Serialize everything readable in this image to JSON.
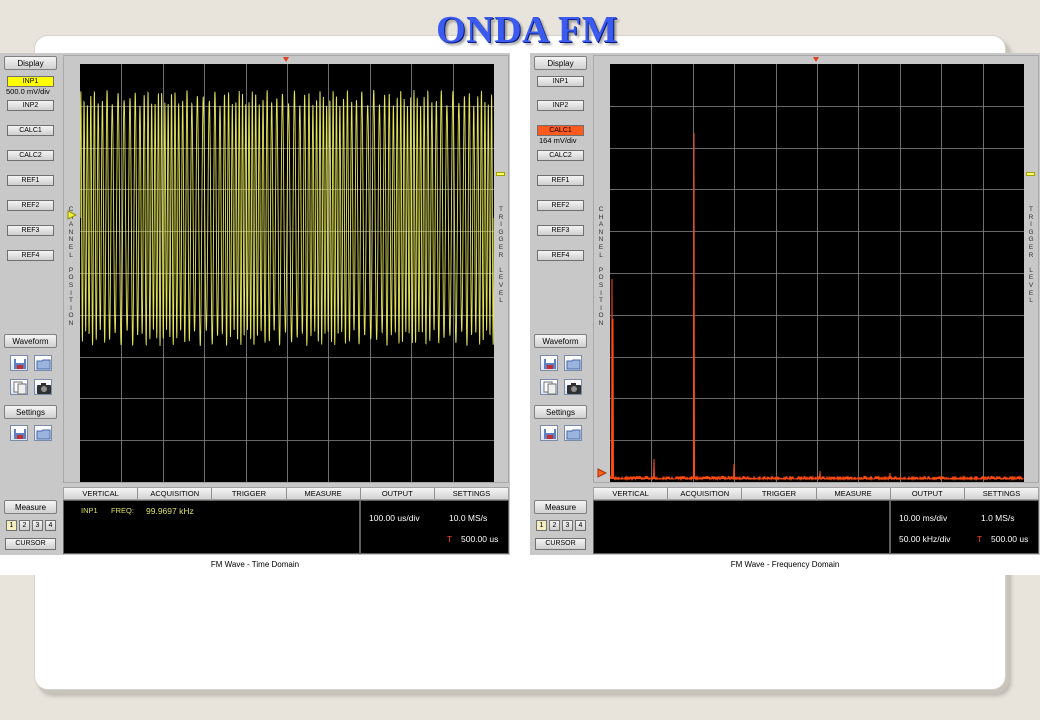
{
  "slide": {
    "title": "ONDA FM"
  },
  "side_labels": {
    "display": "Display",
    "inp1": "INP1",
    "inp2": "INP2",
    "calc1": "CALC1",
    "calc2": "CALC2",
    "ref1": "REF1",
    "ref2": "REF2",
    "ref3": "REF3",
    "ref4": "REF4",
    "waveform": "Waveform",
    "settings": "Settings",
    "measure": "Measure",
    "cursor": "CURSOR",
    "meas_nums": [
      "1",
      "2",
      "3",
      "4"
    ],
    "channel_position": "C\nH\nA\nN\nN\nE\nL\n \nP\nO\nS\nI\nT\nI\nO\nN",
    "trigger_level": "T\nR\nI\nG\nG\nE\nR\n \nL\nE\nV\nE\nL"
  },
  "tabs": [
    "VERTICAL",
    "ACQUISITION",
    "TRIGGER",
    "MEASURE",
    "OUTPUT",
    "SETTINGS"
  ],
  "scope_left": {
    "active_channel": "INP1",
    "scale": "500.0 mV/div",
    "meas_channel": "INP1",
    "meas_label": "FREQ:",
    "meas_value": "99.9697 kHz",
    "timebase": "100.00 us/div",
    "sample_rate": "10.0 MS/s",
    "trigger_marker": "T",
    "trigger_time": "500.00 us",
    "caption": "FM Wave - Time Domain",
    "trace_color": "#f0f060"
  },
  "scope_right": {
    "active_channel": "CALC1",
    "scale": "164 mV/div",
    "timebase": "10.00 ms/div",
    "sample_rate": "1.0 MS/s",
    "freq_scale": "50.00 kHz/div",
    "trigger_marker": "T",
    "trigger_time": "500.00 us",
    "caption": "FM Wave - Frequency Domain",
    "trace_color": "#ff4a10"
  }
}
